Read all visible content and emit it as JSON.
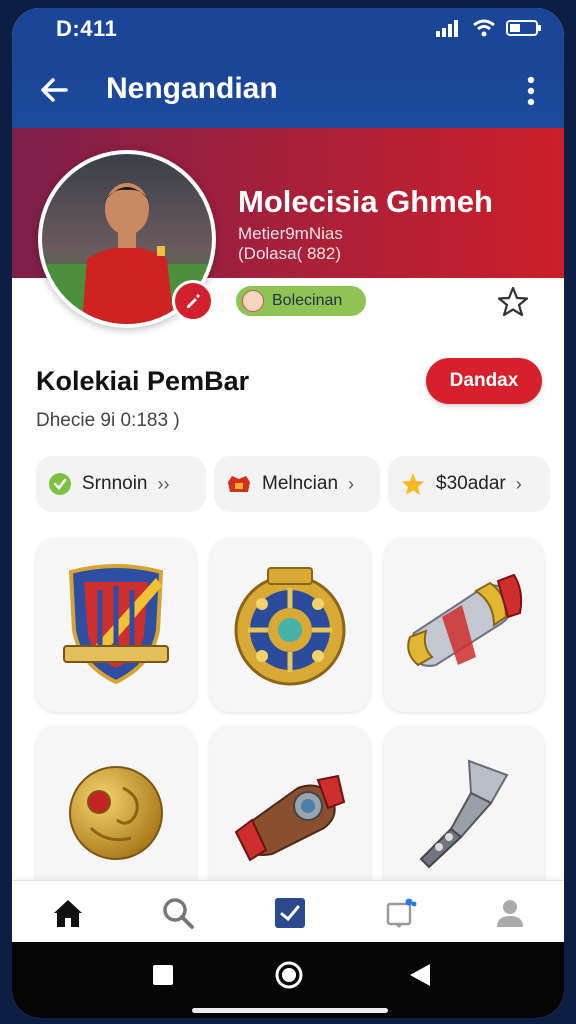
{
  "status_bar": {
    "time": "D:411"
  },
  "app_bar": {
    "title": "Nengandian"
  },
  "profile": {
    "name": "Molecisia Ghmeh",
    "meta_line1": "Metier9mNias",
    "meta_line2": "(Dolasa( 882)",
    "chip_label": "Bolecinan"
  },
  "section": {
    "title": "Kolekiai PemBar",
    "subtitle": "Dhecie 9i 0:183 )",
    "button_label": "Dandax"
  },
  "filters": [
    {
      "label": "Srnnoin",
      "icon": "check-circle-icon"
    },
    {
      "label": "Melncian",
      "icon": "treasure-icon"
    },
    {
      "label": "$30adar",
      "icon": "star-icon"
    }
  ],
  "collection_items": [
    {
      "icon": "crest-shield-icon"
    },
    {
      "icon": "medallion-icon"
    },
    {
      "icon": "armor-bracer-icon"
    },
    {
      "icon": "golden-orb-icon"
    },
    {
      "icon": "gauntlet-icon"
    },
    {
      "icon": "silver-hammer-icon"
    }
  ],
  "bottom_nav": [
    "home-icon",
    "search-icon",
    "collection-icon",
    "notifications-icon",
    "profile-icon"
  ],
  "colors": {
    "primary_blue": "#1b4596",
    "accent_red": "#d81f2c",
    "chip_green": "#8fc353"
  }
}
